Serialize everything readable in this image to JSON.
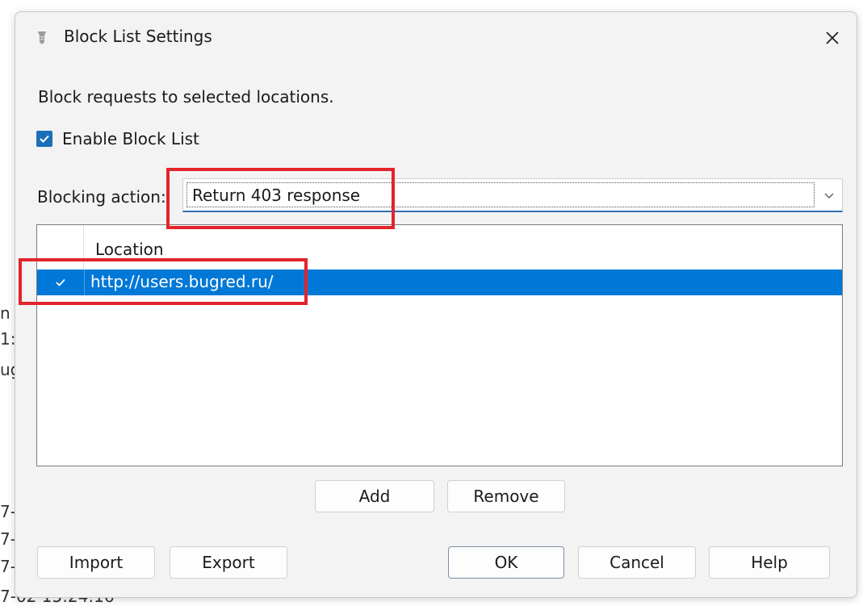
{
  "background_fragments": [
    "n",
    "1:",
    "ug",
    "7-",
    "7-",
    "7-",
    "7-02 15:24:16"
  ],
  "dialog": {
    "title": "Block List Settings",
    "description": "Block requests to selected locations.",
    "enable_checkbox": {
      "label": "Enable Block List",
      "checked": true
    },
    "blocking_action": {
      "label": "Blocking action:",
      "selected": "Return 403 response"
    },
    "list": {
      "columns": [
        "Location"
      ],
      "rows": [
        {
          "checked": true,
          "location": "http://users.bugred.ru/",
          "selected": true
        }
      ]
    },
    "buttons": {
      "add": "Add",
      "remove": "Remove",
      "import": "Import",
      "export": "Export",
      "ok": "OK",
      "cancel": "Cancel",
      "help": "Help"
    }
  },
  "colors": {
    "selection": "#0078d7",
    "checkbox": "#1b6fb8",
    "annotation": "#e3242b",
    "dialog_bg": "#f3f3f3"
  }
}
